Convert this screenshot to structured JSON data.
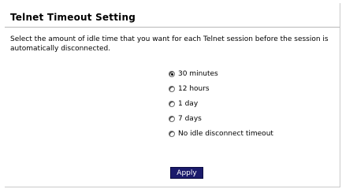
{
  "page": {
    "title": "Telnet Timeout Setting",
    "description": "Select the amount of idle time that you want for each Telnet session before the session is automatically disconnected."
  },
  "timeout_options": [
    {
      "label": "30 minutes",
      "checked": true
    },
    {
      "label": "12 hours",
      "checked": false
    },
    {
      "label": "1 day",
      "checked": false
    },
    {
      "label": "7 days",
      "checked": false
    },
    {
      "label": "No idle disconnect timeout",
      "checked": false
    }
  ],
  "actions": {
    "apply_label": "Apply"
  },
  "colors": {
    "apply_button_bg": "#1a1a6b",
    "divider": "#b8b8b8"
  }
}
